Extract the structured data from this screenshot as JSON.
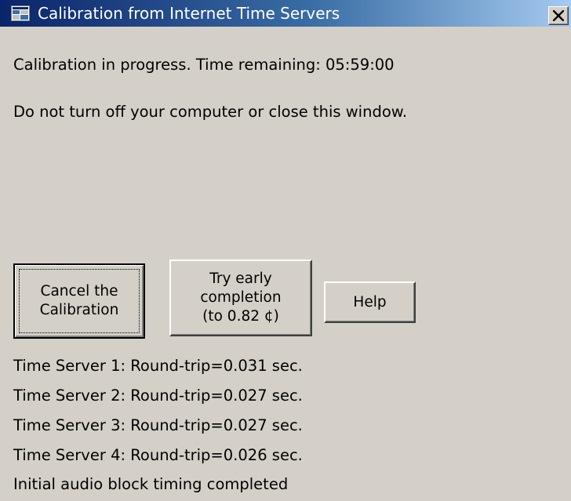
{
  "window": {
    "title": "Calibration from Internet Time Servers",
    "title_icon": "window-app-icon",
    "close_icon": "close-icon"
  },
  "status": {
    "progress_line": "Calibration in progress. Time remaining: 05:59:00",
    "warning_line": "Do not turn off your computer or close this window."
  },
  "buttons": {
    "cancel_label": "Cancel the\nCalibration",
    "early_label": "Try early\ncompletion\n(to 0.82 ¢)",
    "help_label": "Help"
  },
  "log": [
    "Time Server 1: Round-trip=0.031 sec.",
    "Time Server 2: Round-trip=0.027 sec.",
    "Time Server 3: Round-trip=0.027 sec.",
    "Time Server 4: Round-trip=0.026 sec.",
    "Initial audio block timing completed"
  ],
  "colors": {
    "face": "#d4d0c8",
    "title_start": "#0a246a",
    "title_end": "#a6caf0"
  }
}
